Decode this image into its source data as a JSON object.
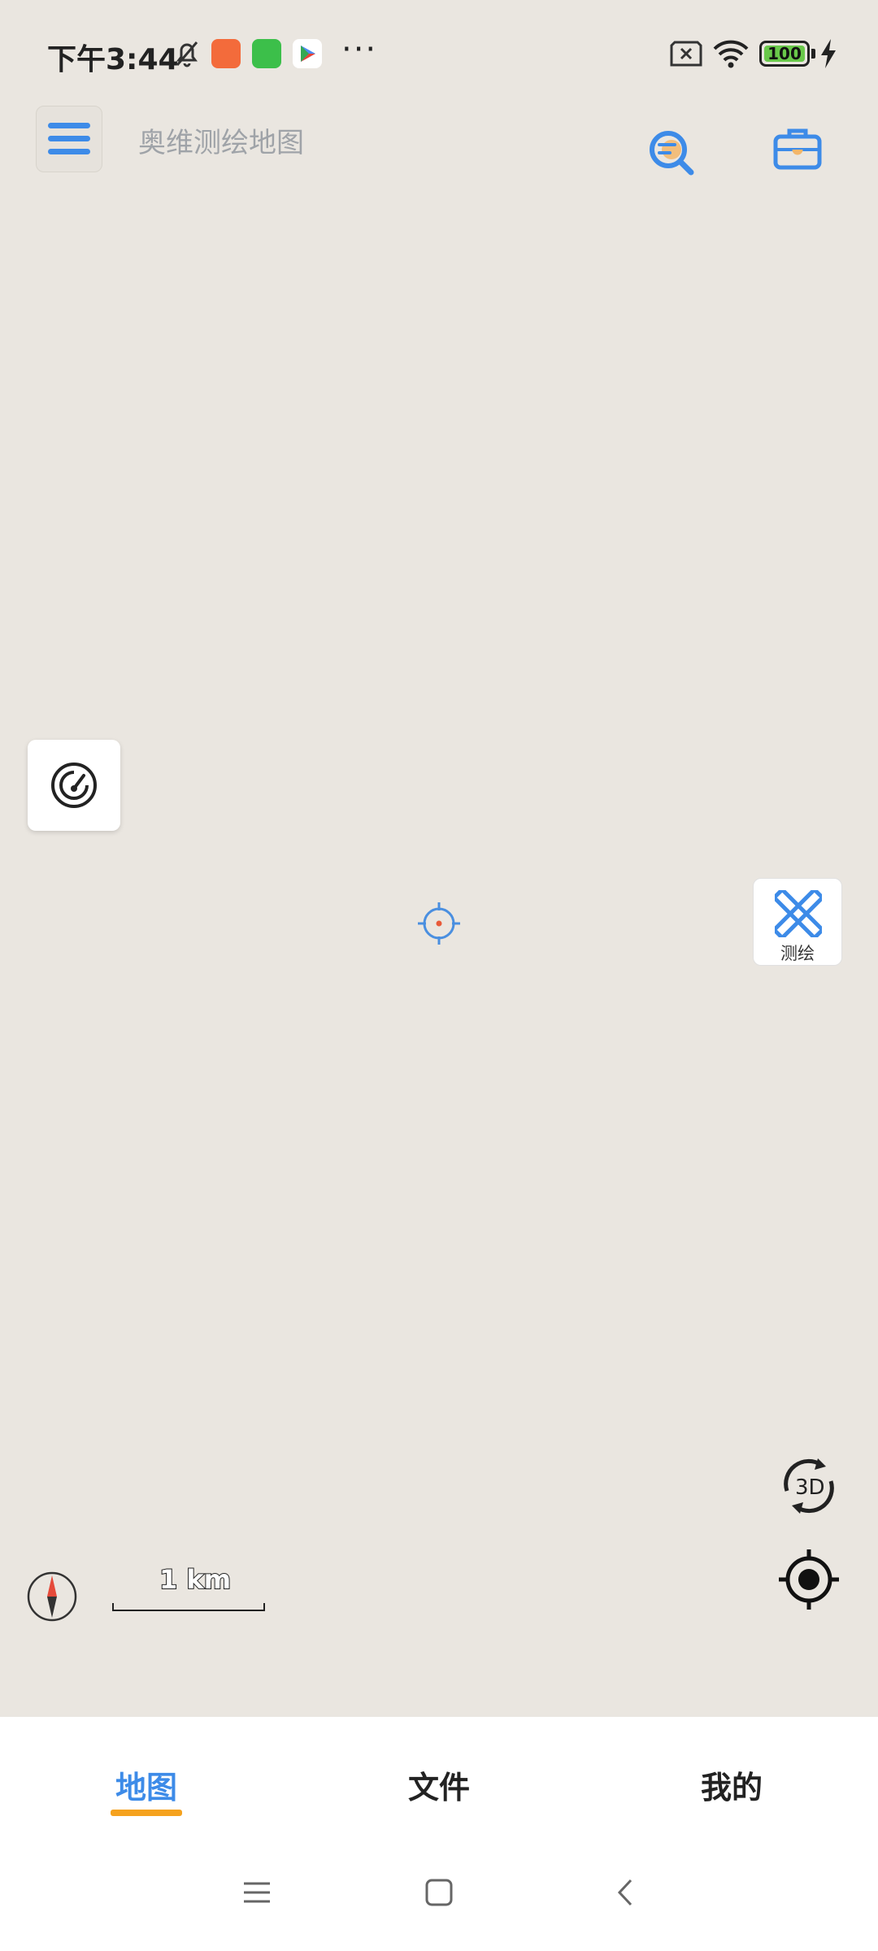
{
  "status_bar": {
    "time": "下午3:44",
    "battery_level": "100",
    "battery_color": "#69c84a",
    "icons": [
      "mute-bell-icon",
      "orange-app-icon",
      "green-app-icon",
      "play-store-icon",
      "more-dots-icon",
      "sim-x-icon",
      "wifi-icon",
      "battery-icon",
      "charging-icon"
    ],
    "dots": "···"
  },
  "top_bar": {
    "search_placeholder": "奥维测绘地图",
    "icons": [
      "menu-icon",
      "search-list-icon",
      "toolbox-icon"
    ],
    "accent_color": "#3d8be8"
  },
  "map_controls": {
    "survey_label": "测绘",
    "scale_label": "1 km",
    "icons": [
      "radar-icon",
      "survey-icon",
      "crosshair-icon",
      "rotate-3d-icon",
      "locate-icon",
      "compass-icon"
    ]
  },
  "bottom_nav": {
    "tabs": [
      {
        "label": "地图",
        "active": true
      },
      {
        "label": "文件",
        "active": false
      },
      {
        "label": "我的",
        "active": false
      }
    ],
    "active_color": "#3d8be8",
    "indicator_color": "#f5a21e"
  },
  "system_nav": {
    "icons": [
      "recents-icon",
      "home-icon",
      "back-icon"
    ]
  }
}
